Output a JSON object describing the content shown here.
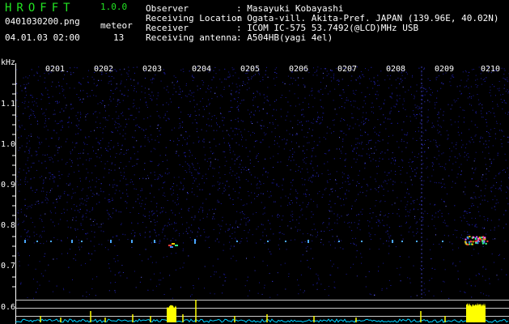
{
  "header": {
    "logo": "HROFFT",
    "version": "1.0.0",
    "filename": "0401030200.png",
    "meteor_label": "meteor",
    "timestamp": "04.01.03 02:00",
    "meteor_count": "13",
    "meta": [
      {
        "key": "Observer",
        "value": ": Masayuki Kobayashi"
      },
      {
        "key": "Receiving Location",
        "value": ": Ogata-vill. Akita-Pref. JAPAN (139.96E, 40.02N)"
      },
      {
        "key": "Receiver",
        "value": ": ICOM IC-575 53.7492(@LCD)MHz USB"
      },
      {
        "key": "Receiving antenna",
        "value": ": A504HB(yagi 4el)"
      }
    ]
  },
  "axis": {
    "unit": "kHz",
    "y_ticks": [
      "1.1",
      "1.0",
      "0.9",
      "0.8",
      "0.7",
      "0.6"
    ],
    "x_ticks": [
      "0201",
      "0202",
      "0203",
      "0204",
      "0205",
      "0206",
      "0207",
      "0208",
      "0209",
      "0210"
    ]
  },
  "colors": {
    "logo": "#22e322",
    "noise": "#1a1a9a",
    "spectrum": "#00d0ff",
    "peak": "#ffff00"
  }
}
